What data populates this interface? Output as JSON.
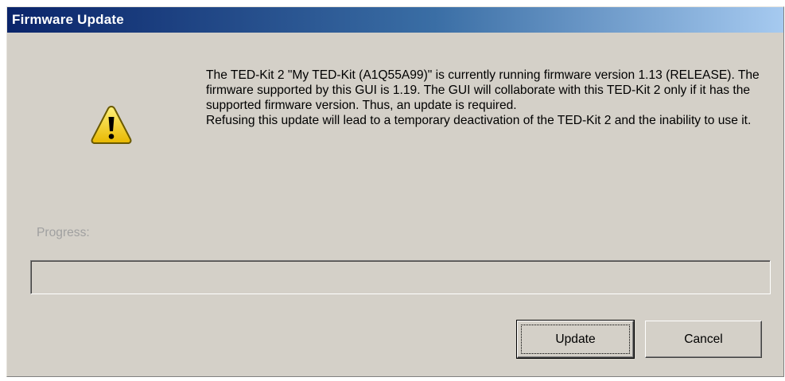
{
  "window": {
    "title": "Firmware Update"
  },
  "dialog": {
    "icon": "warning-icon",
    "message_lines": [
      "The TED-Kit 2 \"My TED-Kit (A1Q55A99)\" is currently running firmware version 1.13 (RELEASE). The firmware supported by this GUI is 1.19. The GUI will collaborate with this TED-Kit 2 only if it has the supported firmware version. Thus, an update is required.",
      "Refusing this update will lead to a temporary deactivation of the TED-Kit 2 and the inability to use it."
    ],
    "progress_label": "Progress:",
    "progress_value": 0
  },
  "buttons": {
    "update_label": "Update",
    "cancel_label": "Cancel"
  },
  "colors": {
    "titlebar_start": "#0a246a",
    "titlebar_end": "#a6caf0",
    "dialog_background": "#d4d0c8",
    "warning_yellow": "#f5d200"
  }
}
